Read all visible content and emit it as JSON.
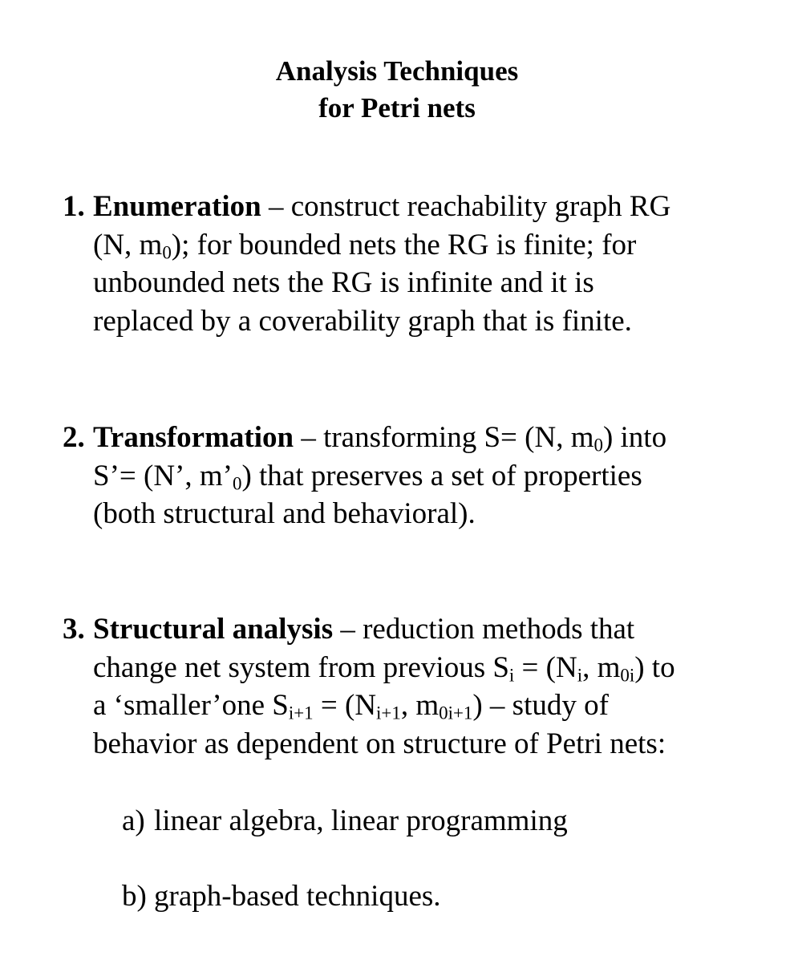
{
  "title": {
    "line1": "Analysis Techniques",
    "line2": "for Petri nets"
  },
  "items": [
    {
      "number": "1.",
      "term": "Enumeration",
      "lines": [
        " – construct reachability graph RG",
        "(N, m",
        "0",
        "); for bounded nets the RG is finite; for",
        "unbounded nets the RG is infinite and it is",
        "replaced by a coverability graph that is finite."
      ]
    },
    {
      "number": "2.",
      "term": "Transformation",
      "lines": [
        " – transforming S= (N, m",
        "0",
        ") into",
        "S’= (N’, m’",
        "0",
        ") that preserves a set of properties",
        "(both structural and behavioral)."
      ]
    },
    {
      "number": "3.",
      "term": "Structural analysis",
      "lines": [
        " – reduction methods that",
        "change net system from previous S",
        "i",
        " = (N",
        "i",
        ", m",
        "0i",
        ") to",
        "a ‘smaller’one S",
        "i+1",
        " = (N",
        "i+1",
        ", m",
        "0i+1",
        ") – study of",
        "behavior as dependent on structure of Petri nets:"
      ]
    }
  ],
  "subitems": [
    {
      "letter": "a)",
      "text": "linear algebra, linear programming"
    },
    {
      "letter": "b)",
      "text": "graph-based techniques."
    }
  ]
}
